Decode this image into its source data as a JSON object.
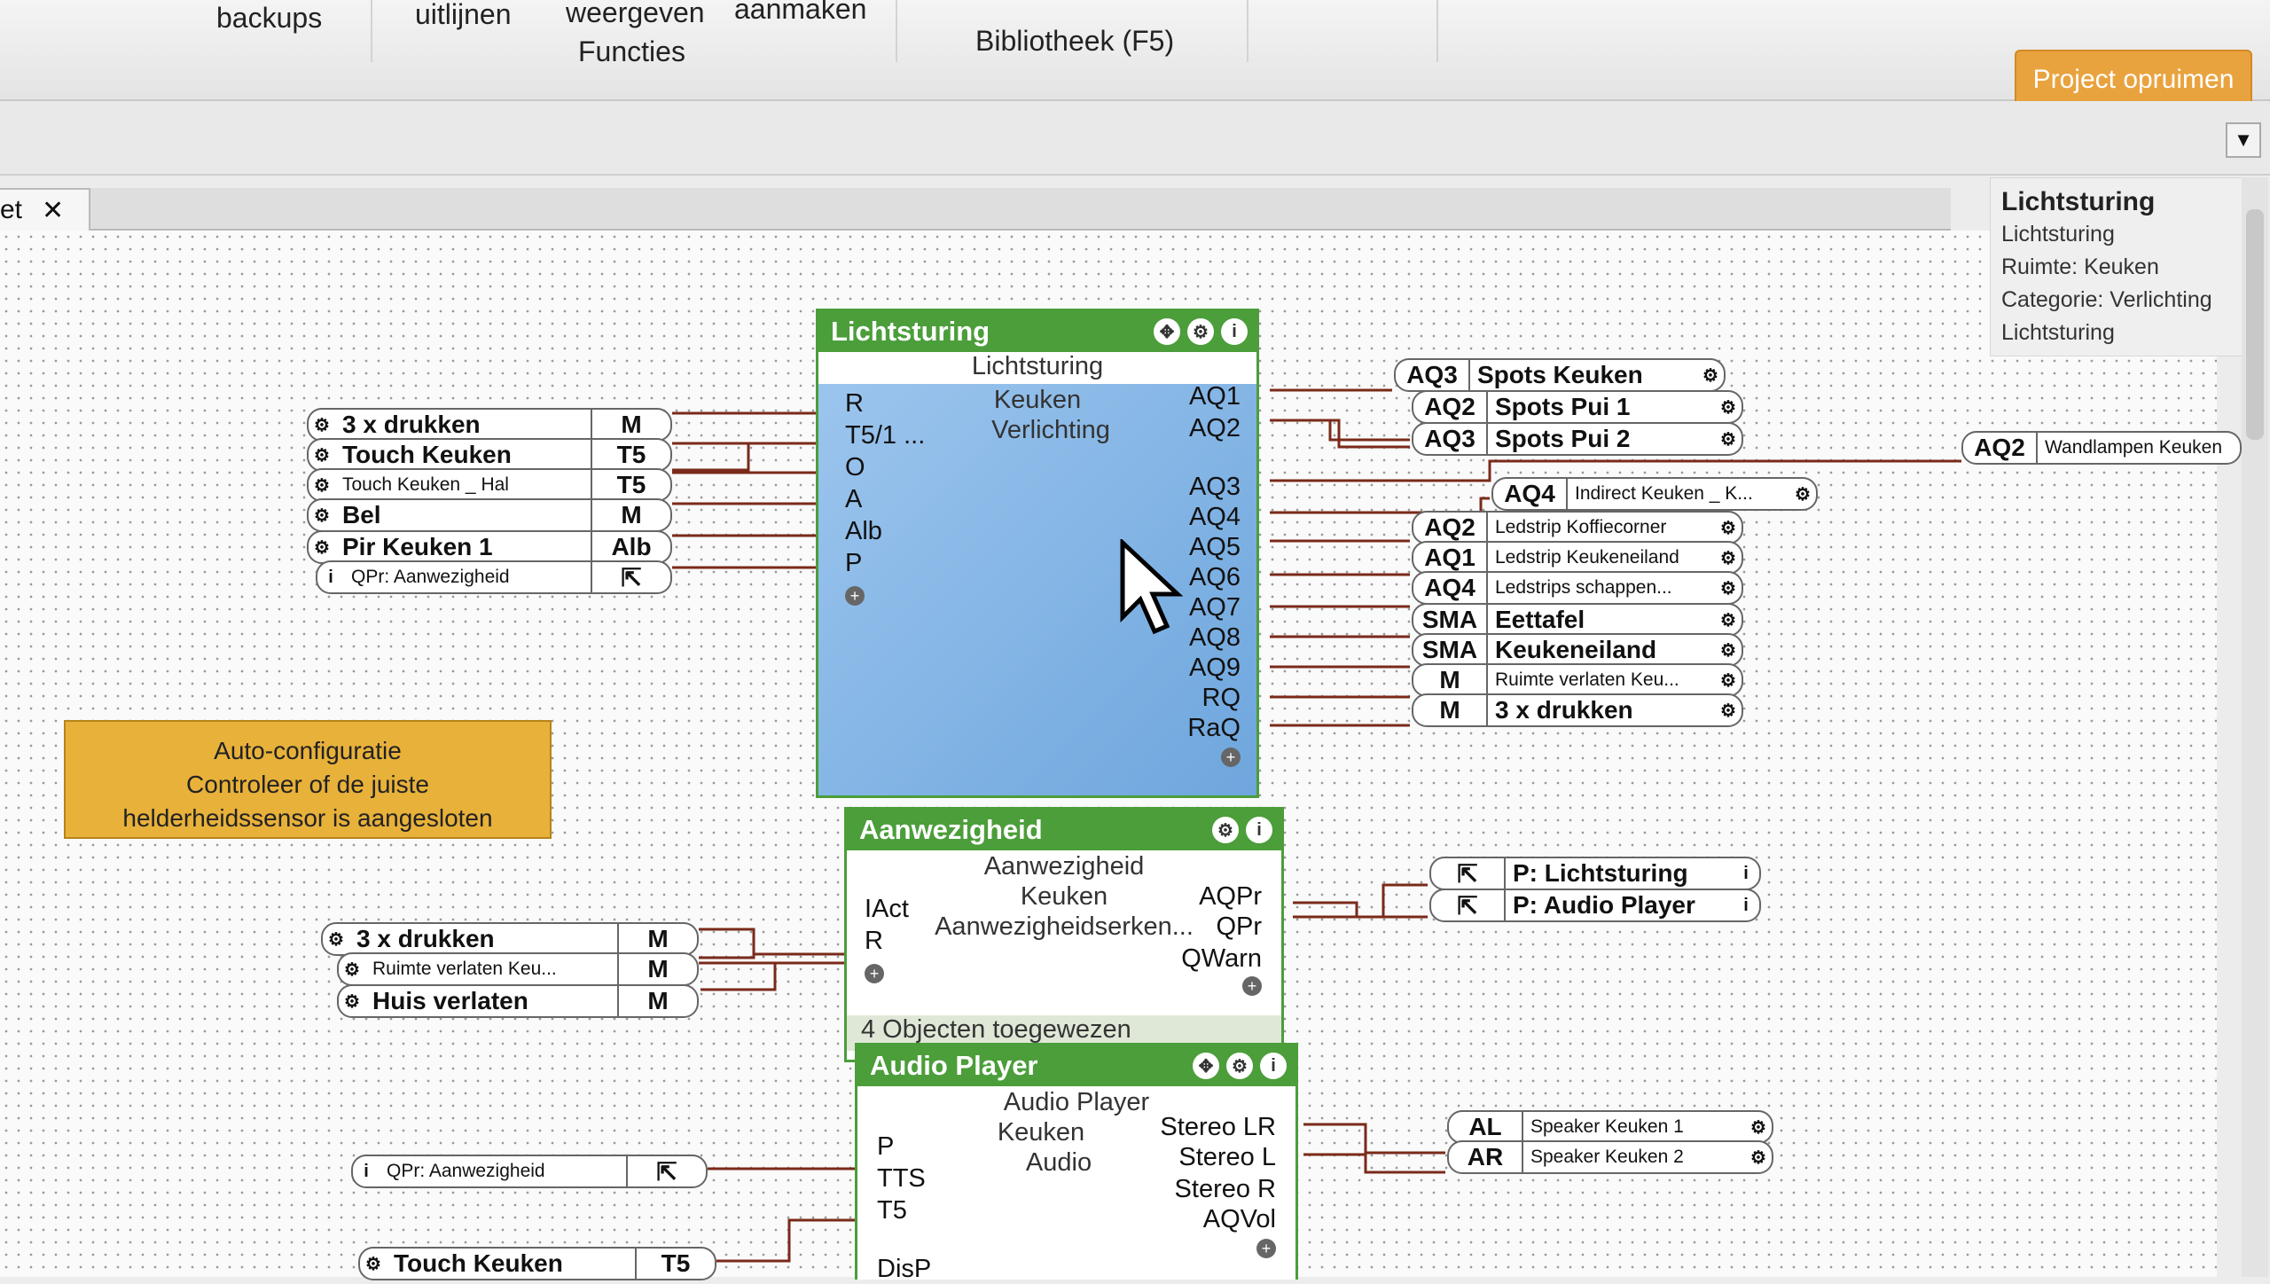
{
  "ribbon": {
    "items": [
      "backups",
      "uitlijnen",
      "weergeven",
      "aanmaken",
      "Functies",
      "Bibliotheek (F5)"
    ],
    "button": "Project opruimen"
  },
  "tab": {
    "label": "et",
    "close": "✕"
  },
  "properties": {
    "title": "Lichtsturing",
    "lines": [
      "Lichtsturing",
      "Ruimte: Keuken",
      "Categorie: Verlichting",
      "Lichtsturing"
    ]
  },
  "warning": {
    "lines": [
      "Auto-configuratie",
      "Controleer of de juiste",
      "helderheidssensor is aangesloten"
    ]
  },
  "block_licht": {
    "title": "Lichtsturing",
    "sub": [
      "Lichtsturing",
      "Keuken",
      "Verlichting"
    ],
    "inputs": [
      "R",
      "T5/1 ...",
      "O",
      "A",
      "Alb",
      "P"
    ],
    "outputs": [
      "AQ1",
      "AQ2",
      "AQ3",
      "AQ4",
      "AQ5",
      "AQ6",
      "AQ7",
      "AQ8",
      "AQ9",
      "RQ",
      "RaQ"
    ]
  },
  "block_aanw": {
    "title": "Aanwezigheid",
    "sub": [
      "Aanwezigheid",
      "Keuken",
      "Aanwezigheidserken..."
    ],
    "inputs": [
      "IAct",
      "R"
    ],
    "outputs": [
      "AQPr",
      "QPr",
      "QWarn"
    ],
    "objects": "4 Objecten toegewezen"
  },
  "block_audio": {
    "title": "Audio Player",
    "sub": [
      "Audio Player",
      "Keuken",
      "Audio"
    ],
    "inputs": [
      "P",
      "TTS",
      "T5",
      "DisP"
    ],
    "outputs": [
      "Stereo LR",
      "Stereo L",
      "Stereo R",
      "AQVol"
    ]
  },
  "inputs_licht": [
    {
      "label": "3 x drukken",
      "tag": "M"
    },
    {
      "label": "Touch Keuken",
      "tag": "T5"
    },
    {
      "label": "Touch Keuken _ Hal",
      "tag": "T5"
    },
    {
      "label": "Bel",
      "tag": "M"
    },
    {
      "label": "Pir Keuken 1",
      "tag": "Alb"
    },
    {
      "label": "QPr: Aanwezigheid",
      "tag": "⇱"
    }
  ],
  "inputs_aanw": [
    {
      "label": "3 x drukken",
      "tag": "M"
    },
    {
      "label": "Ruimte verlaten Keu...",
      "tag": "M"
    },
    {
      "label": "Huis verlaten",
      "tag": "M"
    }
  ],
  "inputs_audio": [
    {
      "label": "QPr: Aanwezigheid",
      "tag": "⇱"
    },
    {
      "label": "Touch Keuken",
      "tag": "T5"
    }
  ],
  "outputs_licht": [
    {
      "tag": "AQ3",
      "label": "Spots Keuken"
    },
    {
      "tag": "AQ2",
      "label": "Spots Pui 1"
    },
    {
      "tag": "AQ3",
      "label": "Spots Pui 2"
    },
    {
      "tag": "AQ4",
      "label": "Indirect Keuken _ K..."
    },
    {
      "tag": "AQ2",
      "label": "Ledstrip Koffiecorner"
    },
    {
      "tag": "AQ1",
      "label": "Ledstrip Keukeneiland"
    },
    {
      "tag": "AQ4",
      "label": "Ledstrips schappen..."
    },
    {
      "tag": "SMA",
      "label": "Eettafel"
    },
    {
      "tag": "SMA",
      "label": "Keukeneiland"
    },
    {
      "tag": "M",
      "label": "Ruimte verlaten Keu..."
    },
    {
      "tag": "M",
      "label": "3 x drukken"
    }
  ],
  "wandlampen": {
    "tag": "AQ2",
    "label": "Wandlampen Keuken"
  },
  "outputs_aanw": [
    {
      "label": "P: Lichtsturing"
    },
    {
      "label": "P: Audio Player"
    }
  ],
  "outputs_audio": [
    {
      "tag": "AL",
      "label": "Speaker Keuken 1"
    },
    {
      "tag": "AR",
      "label": "Speaker Keuken 2"
    }
  ]
}
